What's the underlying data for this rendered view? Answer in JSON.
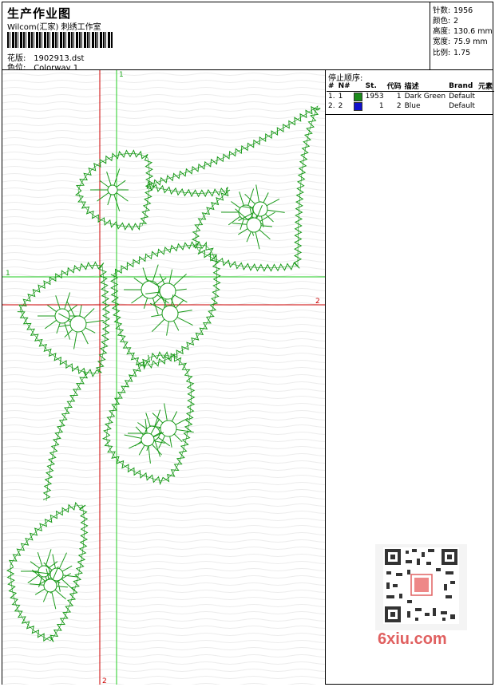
{
  "header": {
    "title": "生产作业图",
    "studio": "Wilcom(汇家) 刺绣工作室",
    "design_label": "花版:",
    "design_value": "1902913.dst",
    "colorway_label": "色位:",
    "colorway_value": "Colorway 1"
  },
  "stats": {
    "stitches_label": "针数:",
    "stitches_value": "1956",
    "colors_label": "颜色:",
    "colors_value": "2",
    "height_label": "高度:",
    "height_value": "130.6 mm",
    "width_label": "宽度:",
    "width_value": "75.9 mm",
    "scale_label": "比例:",
    "scale_value": "1.75"
  },
  "stop_sequence": {
    "title": "停止顺序:",
    "columns": [
      "#",
      "N#",
      "",
      "St.",
      "代码",
      "描述",
      "Brand",
      "元素"
    ],
    "rows": [
      {
        "idx": "1.",
        "n": "1",
        "color": "#1a8a1a",
        "st": "1953",
        "code": "1",
        "desc": "Dark Green",
        "brand": "Default"
      },
      {
        "idx": "2.",
        "n": "2",
        "color": "#1010cc",
        "st": "1",
        "code": "2",
        "desc": "Blue",
        "brand": "Default"
      }
    ]
  },
  "canvas": {
    "axis_h_label_left": "1",
    "axis_h_label_right": "2",
    "axis_v_label_top": "1",
    "axis_v_label_bottom": "2",
    "stitch_color": "#1a9a1a",
    "red_axis_color": "#cc0000",
    "green_axis_color": "#22cc22"
  },
  "watermark": {
    "url": "6xiu.com"
  }
}
